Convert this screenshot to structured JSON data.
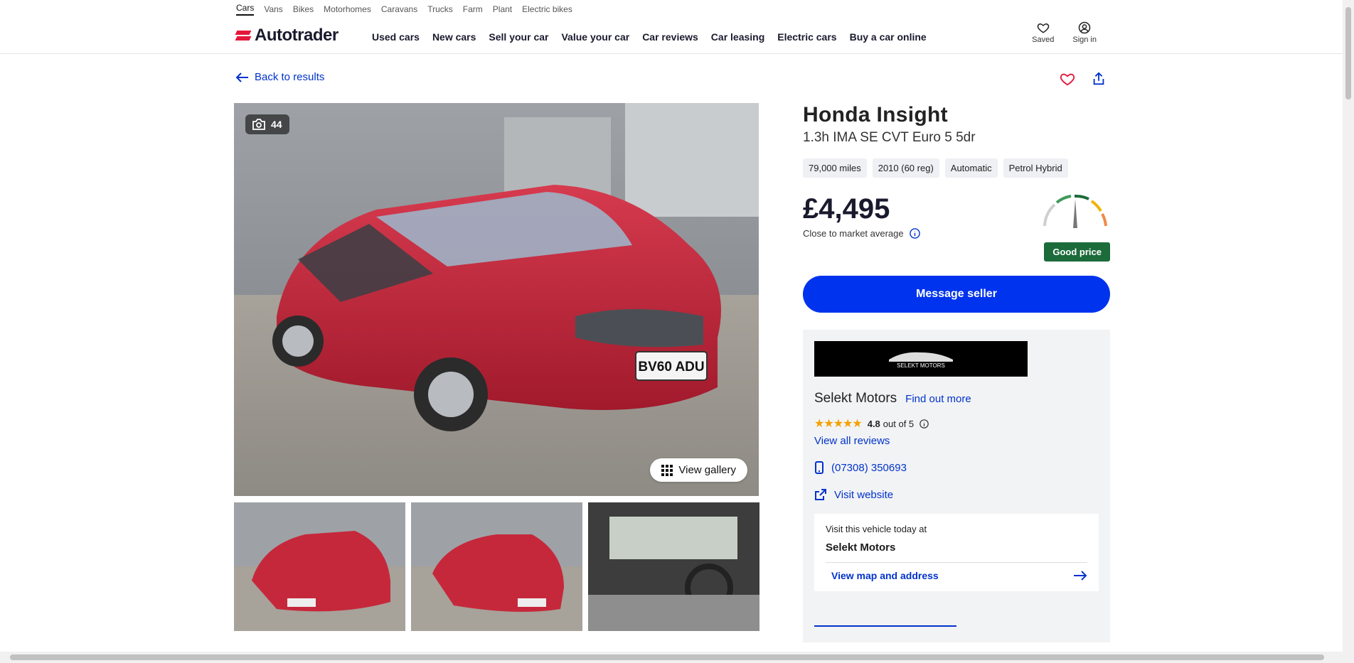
{
  "categories": [
    "Cars",
    "Vans",
    "Bikes",
    "Motorhomes",
    "Caravans",
    "Trucks",
    "Farm",
    "Plant",
    "Electric bikes"
  ],
  "header": {
    "logo": "Autotrader",
    "nav": [
      "Used cars",
      "New cars",
      "Sell your car",
      "Value your car",
      "Car reviews",
      "Car leasing",
      "Electric cars",
      "Buy a car online"
    ],
    "saved_label": "Saved",
    "signin_label": "Sign in"
  },
  "back_label": "Back to results",
  "gallery": {
    "photo_count": "44",
    "view_gallery_label": "View gallery",
    "plate": "BV60 ADU"
  },
  "listing": {
    "title": "Honda Insight",
    "subtitle": "1.3h IMA SE CVT Euro 5 5dr",
    "specs": [
      "79,000 miles",
      "2010 (60 reg)",
      "Automatic",
      "Petrol Hybrid"
    ],
    "price": "£4,495",
    "price_note": "Close to market average",
    "price_rating": "Good price",
    "message_button": "Message seller"
  },
  "dealer": {
    "logo_text": "SELEKT MOTORS",
    "name": "Selekt Motors",
    "find_out_more": "Find out more",
    "rating_value": "4.8",
    "rating_suffix": "out of 5",
    "stars": "★★★★★",
    "view_reviews": "View all reviews",
    "phone": "(07308) 350693",
    "website": "Visit website",
    "visit_heading": "Visit this vehicle today at",
    "visit_dealer": "Selekt Motors",
    "map_link": "View map and address"
  },
  "colors": {
    "brand_red": "#e4173b",
    "link_blue": "#0033cc",
    "button_blue": "#0033ee",
    "good_green": "#1c6b3a"
  }
}
